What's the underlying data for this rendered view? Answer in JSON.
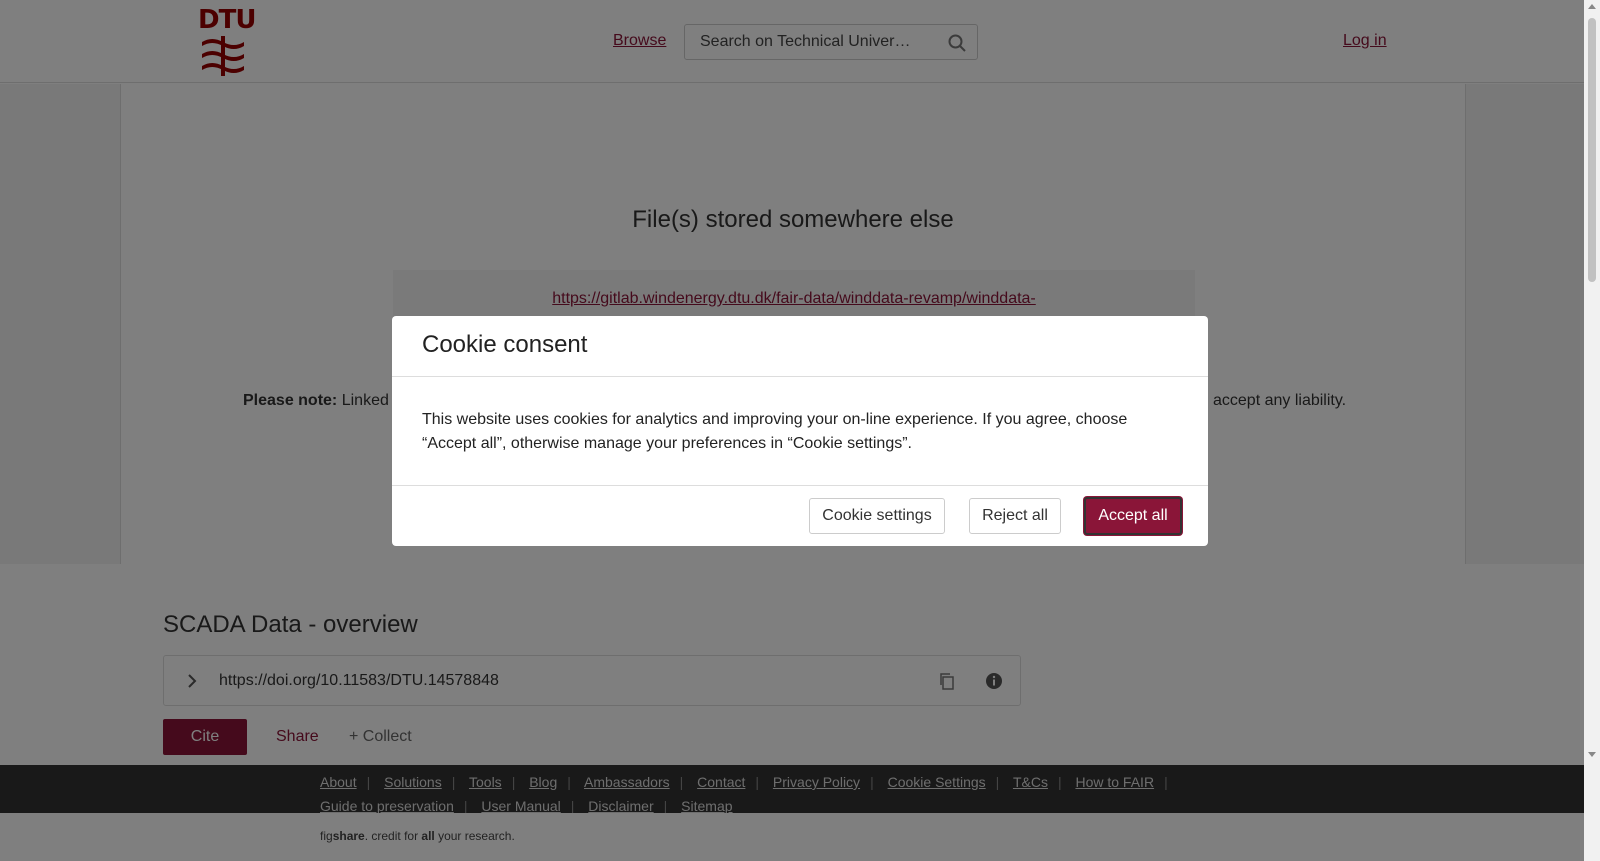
{
  "header": {
    "browse_label": "Browse",
    "search_placeholder": "Search on Technical Univer…",
    "login_label": "Log in",
    "logo_text": "DTU"
  },
  "preview": {
    "title": "File(s) stored somewhere else",
    "link_text": "https://gitlab.windenergy.dtu.dk/fair-data/winddata-revamp/winddata-",
    "note_label": "Please note:",
    "note_text": "Linked",
    "note_tail": "accept any liability."
  },
  "item": {
    "title": "SCADA Data - overview",
    "doi": "https://doi.org/10.11583/DTU.14578848",
    "cite_label": "Cite",
    "share_label": "Share",
    "collect_label": "+ Collect"
  },
  "footer": {
    "links": [
      "About",
      "Solutions",
      "Tools",
      "Blog",
      "Ambassadors",
      "Contact",
      "Privacy Policy",
      "Cookie Settings",
      "T&Cs",
      "How to FAIR",
      "Guide to preservation",
      "User Manual",
      "Disclaimer",
      "Sitemap"
    ],
    "credit_prefix": "fig",
    "credit_brand": "share",
    "credit_middle": ". credit for ",
    "credit_all": "all",
    "credit_suffix": " your research."
  },
  "modal": {
    "title": "Cookie consent",
    "body": "This website uses cookies for analytics and improving your on-line experience. If you agree, choose “Accept all”, otherwise manage your preferences in “Cookie settings”.",
    "settings_label": "Cookie settings",
    "reject_label": "Reject all",
    "accept_label": "Accept all"
  },
  "colors": {
    "accent": "#8a1538",
    "logo": "#990000",
    "footer_bg": "#333333"
  },
  "icons": [
    "search-icon",
    "chevron-right-icon",
    "copy-icon",
    "info-icon",
    "dtu-logo-icon"
  ]
}
